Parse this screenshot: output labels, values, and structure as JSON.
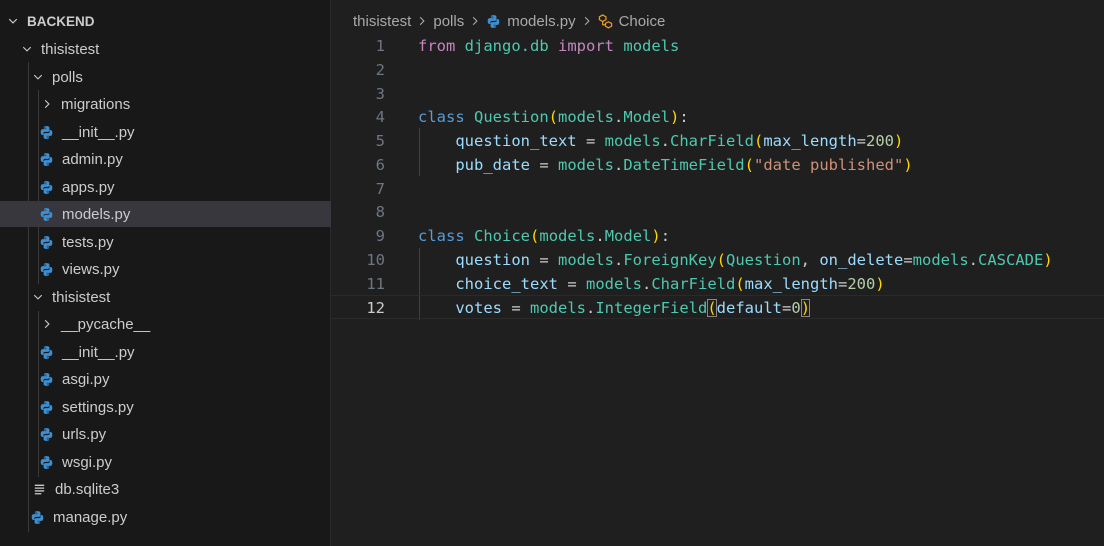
{
  "explorer": {
    "section_title": "BACKEND",
    "items": [
      {
        "label": "thisistest",
        "type": "folder"
      },
      {
        "label": "polls",
        "type": "folder"
      },
      {
        "label": "migrations",
        "type": "folder"
      },
      {
        "label": "__init__.py",
        "type": "python"
      },
      {
        "label": "admin.py",
        "type": "python"
      },
      {
        "label": "apps.py",
        "type": "python"
      },
      {
        "label": "models.py",
        "type": "python"
      },
      {
        "label": "tests.py",
        "type": "python"
      },
      {
        "label": "views.py",
        "type": "python"
      },
      {
        "label": "thisistest",
        "type": "folder"
      },
      {
        "label": "__pycache__",
        "type": "folder"
      },
      {
        "label": "__init__.py",
        "type": "python"
      },
      {
        "label": "asgi.py",
        "type": "python"
      },
      {
        "label": "settings.py",
        "type": "python"
      },
      {
        "label": "urls.py",
        "type": "python"
      },
      {
        "label": "wsgi.py",
        "type": "python"
      },
      {
        "label": "db.sqlite3",
        "type": "file"
      },
      {
        "label": "manage.py",
        "type": "python"
      }
    ]
  },
  "breadcrumb": {
    "parts": [
      "thisistest",
      "polls",
      "models.py",
      "Choice"
    ]
  },
  "editor": {
    "line_numbers": [
      "1",
      "2",
      "3",
      "4",
      "5",
      "6",
      "7",
      "8",
      "9",
      "10",
      "11",
      "12"
    ],
    "active_line": "12",
    "code": {
      "l1": {
        "kw_from": "from",
        "mod": "django.db",
        "kw_import": "import",
        "name": "models"
      },
      "l4": {
        "kw_class": "class",
        "cls": "Question",
        "base_mod": "models",
        "base_cls": "Model",
        "colon": ":"
      },
      "l5": {
        "attr": "question_text",
        "eq": " = ",
        "mod": "models",
        "fn": "CharField",
        "param": "max_length",
        "num": "200"
      },
      "l6": {
        "attr": "pub_date",
        "eq": " = ",
        "mod": "models",
        "fn": "DateTimeField",
        "str": "\"date published\""
      },
      "l9": {
        "kw_class": "class",
        "cls": "Choice",
        "base_mod": "models",
        "base_cls": "Model",
        "colon": ":"
      },
      "l10": {
        "attr": "question",
        "eq": " = ",
        "mod": "models",
        "fn": "ForeignKey",
        "arg": "Question",
        "param": "on_delete",
        "mod2": "models",
        "const": "CASCADE"
      },
      "l11": {
        "attr": "choice_text",
        "eq": " = ",
        "mod": "models",
        "fn": "CharField",
        "param": "max_length",
        "num": "200"
      },
      "l12": {
        "attr": "votes",
        "eq": " = ",
        "mod": "models",
        "fn": "IntegerField",
        "param": "default",
        "num": "0"
      }
    }
  },
  "colors": {
    "sidebar_bg": "#181818",
    "editor_bg": "#1f1f1f",
    "selected_row": "#37373d",
    "python_icon": "#3e8fd1",
    "symbol_icon": "#ee9d28"
  },
  "icons": {
    "python": "python-file-icon",
    "file": "text-file-icon",
    "folder_open": "chevron-down-icon",
    "folder_closed": "chevron-right-icon",
    "symbol": "class-symbol-icon"
  }
}
